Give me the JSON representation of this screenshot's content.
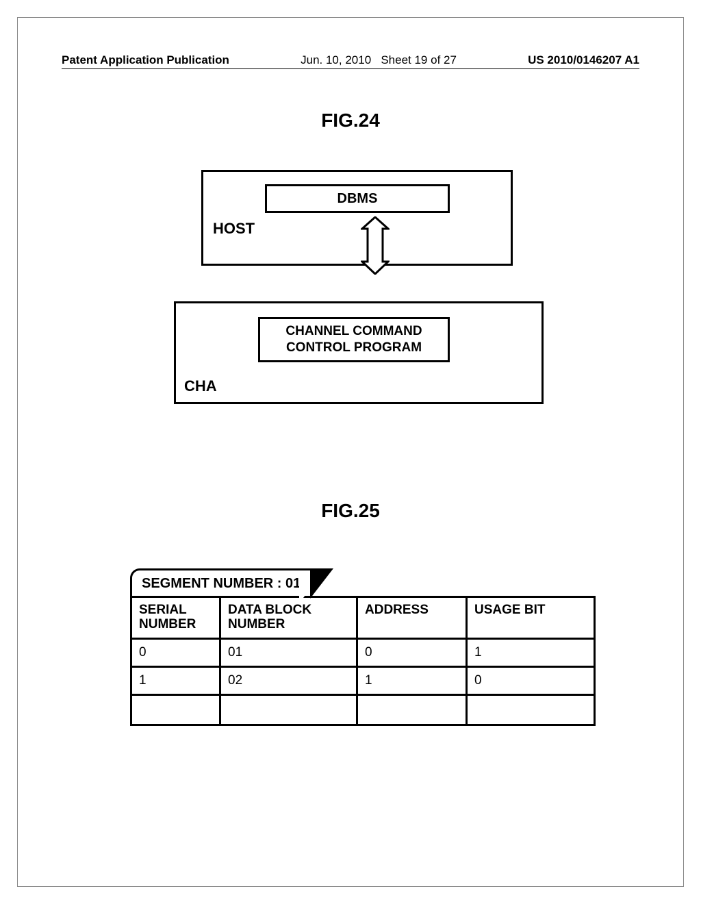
{
  "header": {
    "left": "Patent Application Publication",
    "date": "Jun. 10, 2010",
    "sheet": "Sheet 19 of 27",
    "pubno": "US 2010/0146207 A1"
  },
  "fig24": {
    "title": "FIG.24",
    "host_label": "HOST",
    "dbms_label": "DBMS",
    "cha_label": "CHA",
    "ccp_line1": "CHANNEL COMMAND",
    "ccp_line2": "CONTROL PROGRAM"
  },
  "fig25": {
    "title": "FIG.25",
    "segment_label": "SEGMENT NUMBER : 01",
    "columns": {
      "serial": "SERIAL NUMBER",
      "datablock": "DATA BLOCK NUMBER",
      "address": "ADDRESS",
      "usage": "USAGE BIT"
    },
    "rows": [
      {
        "serial": "0",
        "datablock": "01",
        "address": "0",
        "usage": "1"
      },
      {
        "serial": "1",
        "datablock": "02",
        "address": "1",
        "usage": "0"
      },
      {
        "serial": "",
        "datablock": "",
        "address": "",
        "usage": ""
      }
    ]
  }
}
